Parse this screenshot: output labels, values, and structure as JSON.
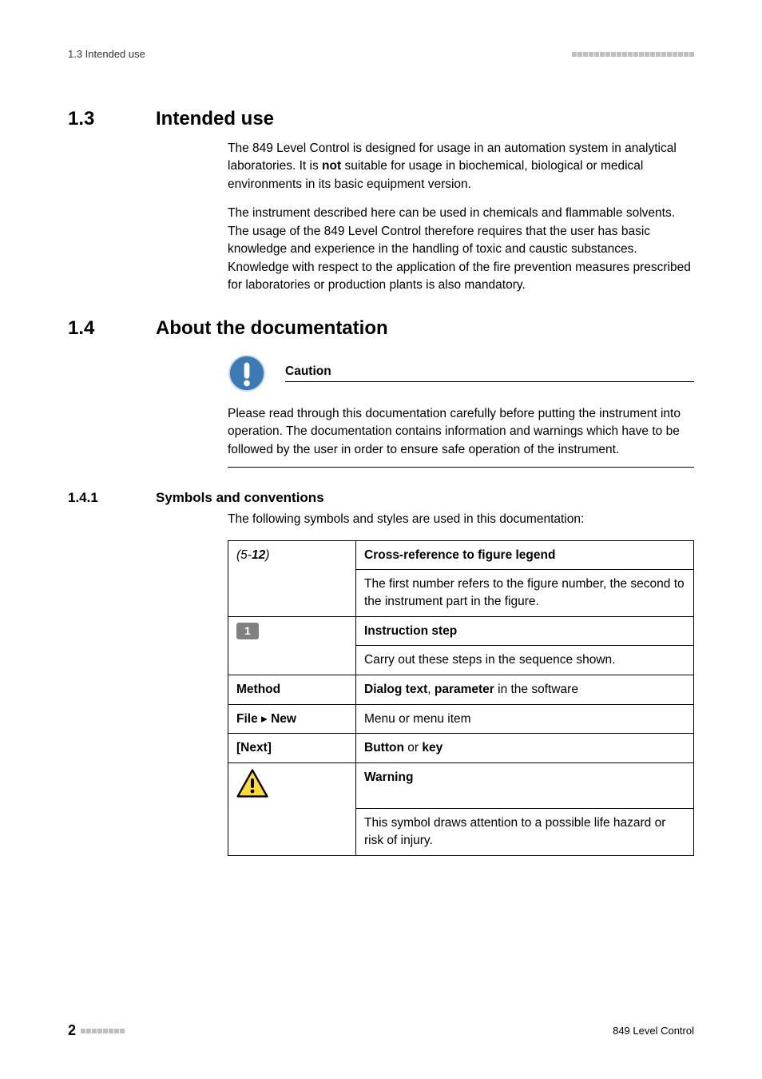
{
  "header": {
    "left": "1.3 Intended use"
  },
  "section13": {
    "number": "1.3",
    "title": "Intended use",
    "p1_a": "The 849 Level Control is designed for usage in an automation system in analytical laboratories. It is ",
    "p1_b": "not",
    "p1_c": " suitable for usage in biochemical, biological or medical environments in its basic equipment version.",
    "p2": "The instrument described here can be used in chemicals and flammable solvents. The usage of the 849 Level Control therefore requires that the user has basic knowledge and experience in the handling of toxic and caustic substances. Knowledge with respect to the application of the fire prevention measures prescribed for laboratories or production plants is also mandatory."
  },
  "section14": {
    "number": "1.4",
    "title": "About the documentation",
    "caution_label": "Caution",
    "caution_body": "Please read through this documentation carefully before putting the instrument into operation. The documentation contains information and warnings which have to be followed by the user in order to ensure safe operation of the instrument."
  },
  "section141": {
    "number": "1.4.1",
    "title": "Symbols and conventions",
    "intro": "The following symbols and styles are used in this documentation:"
  },
  "table": {
    "r1_key_a": "(5-",
    "r1_key_b": "12",
    "r1_key_c": ")",
    "r1_title": "Cross-reference to figure legend",
    "r1_body": "The first number refers to the figure number, the second to the instrument part in the figure.",
    "r2_key": "1",
    "r2_title": "Instruction step",
    "r2_body": "Carry out these steps in the sequence shown.",
    "r3_key": "Method",
    "r3_a": "Dialog text",
    "r3_b": ", ",
    "r3_c": "parameter",
    "r3_d": " in the software",
    "r4_key_a": "File ",
    "r4_key_b": "▸",
    "r4_key_c": " New",
    "r4_val": "Menu or menu item",
    "r5_key": "[Next]",
    "r5_a": "Button",
    "r5_b": " or ",
    "r5_c": "key",
    "r6_title": "Warning",
    "r6_body": "This symbol draws attention to a possible life hazard or risk of injury."
  },
  "footer": {
    "page": "2",
    "right": "849 Level Control"
  }
}
